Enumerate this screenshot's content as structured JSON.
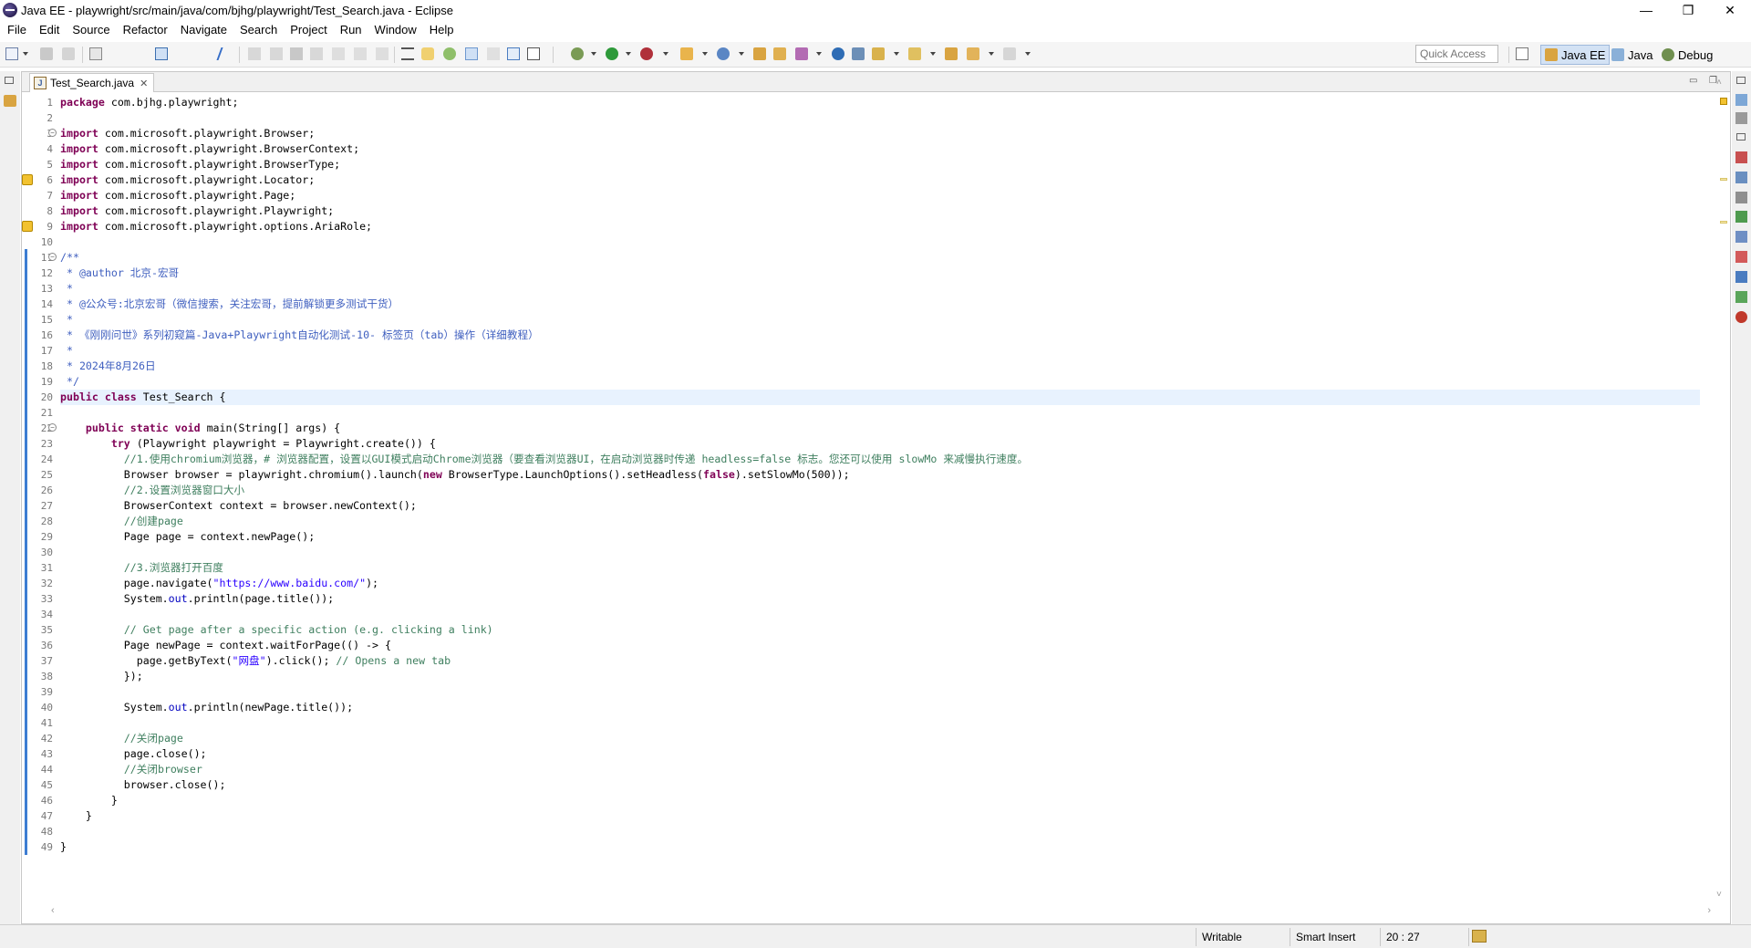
{
  "window": {
    "title": "Java EE - playwright/src/main/java/com/bjhg/playwright/Test_Search.java - Eclipse",
    "minimize": "—",
    "restore": "❐",
    "close": "✕"
  },
  "menu": [
    "File",
    "Edit",
    "Source",
    "Refactor",
    "Navigate",
    "Search",
    "Project",
    "Run",
    "Window",
    "Help"
  ],
  "toolbar": {
    "quick_access_placeholder": "Quick Access",
    "perspectives": [
      "Java EE",
      "Java",
      "Debug"
    ]
  },
  "editor": {
    "tab_title": "Test_Search.java",
    "tab_close": "✕",
    "lines": [
      "package com.bjhg.playwright;",
      "",
      "import com.microsoft.playwright.Browser;",
      "import com.microsoft.playwright.BrowserContext;",
      "import com.microsoft.playwright.BrowserType;",
      "import com.microsoft.playwright.Locator;",
      "import com.microsoft.playwright.Page;",
      "import com.microsoft.playwright.Playwright;",
      "import com.microsoft.playwright.options.AriaRole;",
      "",
      "/**",
      " * @author 北京-宏哥",
      " *",
      " * @公众号:北京宏哥（微信搜索，关注宏哥，提前解锁更多测试干货）",
      " *",
      " * 《刚刚问世》系列初窥篇-Java+Playwright自动化测试-10- 标签页（tab）操作（详细教程）",
      " *",
      " * 2024年8月26日",
      " */",
      "public class Test_Search {",
      "",
      "    public static void main(String[] args) {",
      "        try (Playwright playwright = Playwright.create()) {",
      "          //1.使用chromium浏览器，# 浏览器配置，设置以GUI模式启动Chrome浏览器（要查看浏览器UI，在启动浏览器时传递 headless=false 标志。您还可以使用 slowMo 来减慢执行速度。",
      "          Browser browser = playwright.chromium().launch(new BrowserType.LaunchOptions().setHeadless(false).setSlowMo(500));",
      "          //2.设置浏览器窗口大小",
      "          BrowserContext context = browser.newContext();",
      "          //创建page",
      "          Page page = context.newPage();",
      "",
      "          //3.浏览器打开百度",
      "          page.navigate(\"https://www.baidu.com/\");",
      "          System.out.println(page.title());",
      "",
      "          // Get page after a specific action (e.g. clicking a link)",
      "          Page newPage = context.waitForPage(() -> {",
      "            page.getByText(\"网盘\").click(); // Opens a new tab",
      "          });",
      "",
      "          System.out.println(newPage.title());",
      "",
      "          //关闭page",
      "          page.close();",
      "          //关闭browser",
      "          browser.close();",
      "        }",
      "    }",
      "",
      "}"
    ],
    "current_line": 20
  },
  "status": {
    "writable": "Writable",
    "insert_mode": "Smart Insert",
    "position": "20 : 27"
  },
  "colors": {
    "keyword": "#7f0055",
    "comment": "#3f7f5f",
    "javadoc": "#3f5fbf",
    "string": "#2a00ff",
    "current_line_bg": "#e8f2fe",
    "change_bar": "#3d7dd2"
  }
}
